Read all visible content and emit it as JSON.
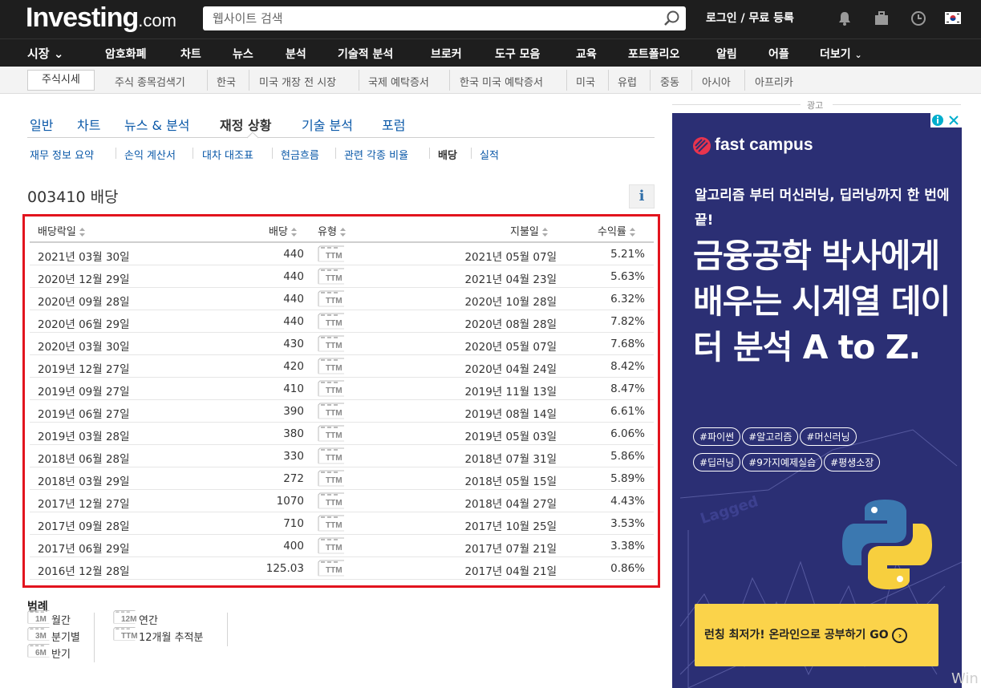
{
  "header": {
    "logo_main": "Investing",
    "logo_suffix": ".com",
    "search_placeholder": "웹사이트 검색",
    "login_label": "로그인 / 무료 등록"
  },
  "nav": {
    "items": [
      "시장",
      "암호화폐",
      "차트",
      "뉴스",
      "분석",
      "기술적 분석",
      "브로커",
      "도구 모음",
      "교육",
      "포트폴리오",
      "알림",
      "어플",
      "더보기"
    ]
  },
  "subnav": {
    "active": "주식시세",
    "items": [
      "주식 종목검색기",
      "한국",
      "미국 개장 전 시장",
      "국제 예탁증서",
      "한국 미국 예탁증서",
      "미국",
      "유럽",
      "중동",
      "아시아",
      "아프리카"
    ]
  },
  "tabs": [
    "일반",
    "차트",
    "뉴스 & 분석",
    "재정 상황",
    "기술 분석",
    "포럼"
  ],
  "active_tab": "재정 상황",
  "subtabs": [
    "재무 정보 요약",
    "손익 계산서",
    "대차 대조표",
    "현금흐름",
    "관련 각종 비율",
    "배당",
    "실적"
  ],
  "active_subtab": "배당",
  "page_title": "003410 배당",
  "table": {
    "headers": {
      "ex_date": "배당락일",
      "dividend": "배당",
      "type": "유형",
      "pay_date": "지불일",
      "yield": "수익률"
    },
    "rows": [
      {
        "ex_date": "2021년 03월 30일",
        "dividend": "440",
        "type": "TTM",
        "pay_date": "2021년 05월 07일",
        "yield": "5.21%"
      },
      {
        "ex_date": "2020년 12월 29일",
        "dividend": "440",
        "type": "TTM",
        "pay_date": "2021년 04월 23일",
        "yield": "5.63%"
      },
      {
        "ex_date": "2020년 09월 28일",
        "dividend": "440",
        "type": "TTM",
        "pay_date": "2020년 10월 28일",
        "yield": "6.32%"
      },
      {
        "ex_date": "2020년 06월 29일",
        "dividend": "440",
        "type": "TTM",
        "pay_date": "2020년 08월 28일",
        "yield": "7.82%"
      },
      {
        "ex_date": "2020년 03월 30일",
        "dividend": "430",
        "type": "TTM",
        "pay_date": "2020년 05월 07일",
        "yield": "7.68%"
      },
      {
        "ex_date": "2019년 12월 27일",
        "dividend": "420",
        "type": "TTM",
        "pay_date": "2020년 04월 24일",
        "yield": "8.42%"
      },
      {
        "ex_date": "2019년 09월 27일",
        "dividend": "410",
        "type": "TTM",
        "pay_date": "2019년 11월 13일",
        "yield": "8.47%"
      },
      {
        "ex_date": "2019년 06월 27일",
        "dividend": "390",
        "type": "TTM",
        "pay_date": "2019년 08월 14일",
        "yield": "6.61%"
      },
      {
        "ex_date": "2019년 03월 28일",
        "dividend": "380",
        "type": "TTM",
        "pay_date": "2019년 05월 03일",
        "yield": "6.06%"
      },
      {
        "ex_date": "2018년 06월 28일",
        "dividend": "330",
        "type": "TTM",
        "pay_date": "2018년 07월 31일",
        "yield": "5.86%"
      },
      {
        "ex_date": "2018년 03월 29일",
        "dividend": "272",
        "type": "TTM",
        "pay_date": "2018년 05월 15일",
        "yield": "5.89%"
      },
      {
        "ex_date": "2017년 12월 27일",
        "dividend": "1070",
        "type": "TTM",
        "pay_date": "2018년 04월 27일",
        "yield": "4.43%"
      },
      {
        "ex_date": "2017년 09월 28일",
        "dividend": "710",
        "type": "TTM",
        "pay_date": "2017년 10월 25일",
        "yield": "3.53%"
      },
      {
        "ex_date": "2017년 06월 29일",
        "dividend": "400",
        "type": "TTM",
        "pay_date": "2017년 07월 21일",
        "yield": "3.38%"
      },
      {
        "ex_date": "2016년 12월 28일",
        "dividend": "125.03",
        "type": "TTM",
        "pay_date": "2017년 04월 21일",
        "yield": "0.86%"
      }
    ]
  },
  "legend": {
    "title": "범례",
    "items": [
      {
        "code": "1M",
        "label": "월간"
      },
      {
        "code": "3M",
        "label": "분기별"
      },
      {
        "code": "6M",
        "label": "반기"
      },
      {
        "code": "12M",
        "label": "연간"
      },
      {
        "code": "TTM",
        "label": "12개월 추적분"
      }
    ]
  },
  "ad": {
    "label": "광고",
    "brand": "fast campus",
    "lead": "알고리즘 부터 머신러닝, 딥러닝까지 한 번에 끝!",
    "headline": "금융공학 박사에게 배우는 시계열 데이터 분석 A to Z.",
    "tags": [
      "#파이썬",
      "#알고리즘",
      "#머신러닝",
      "#딥러닝",
      "#9가지예제실습",
      "#평생소장"
    ],
    "chart_text": "Lagged",
    "cta": "런칭 최저가! 온라인으로 공부하기 GO",
    "bg_color": "#2b2f74",
    "cta_color": "#fbd34a"
  },
  "highlight_color": "#e2141e",
  "watermark": "Win"
}
